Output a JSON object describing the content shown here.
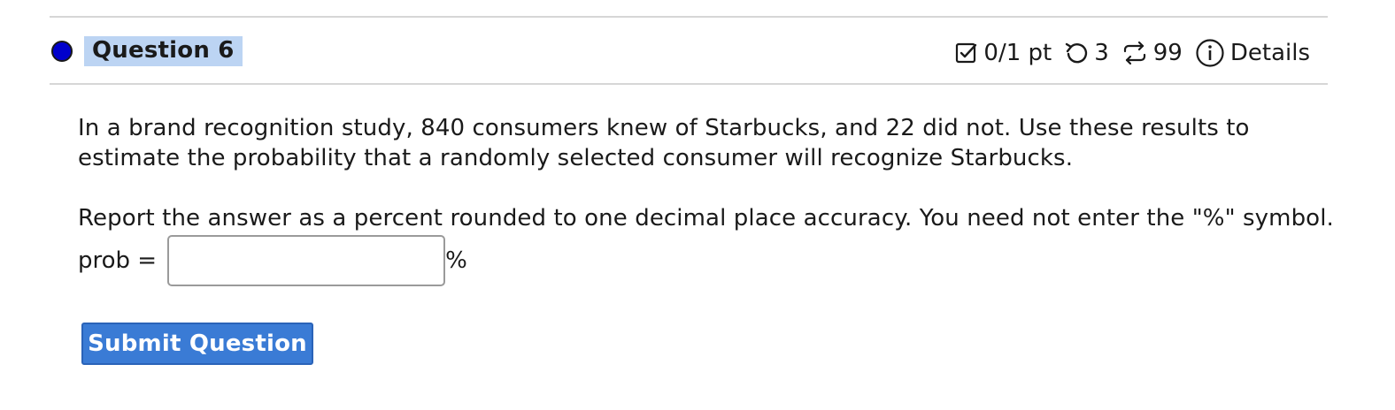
{
  "question": {
    "title": "Question 6",
    "score": "0/1 pt",
    "retries": "3",
    "attempts": "99",
    "details_label": "Details",
    "body": "In a brand recognition study, 840 consumers knew of Starbucks, and 22 did not. Use these results to estimate the probability that a randomly selected consumer will recognize Starbucks.",
    "instructions": "Report the answer as a percent rounded to one decimal place accuracy. You need not enter the \"%\" symbol.",
    "answer_label": "prob =",
    "answer_value": "",
    "answer_unit": "%",
    "submit_label": "Submit Question"
  },
  "icons": {
    "status": "status-dot-icon",
    "score": "checkbox-icon",
    "retries": "undo-icon",
    "attempts": "repeat-icon",
    "details": "info-icon"
  },
  "colors": {
    "status_dot": "#0000cc",
    "title_highlight": "#bcd4f3",
    "submit_bg": "#3a7bd5",
    "rule": "#d6d6d6"
  }
}
